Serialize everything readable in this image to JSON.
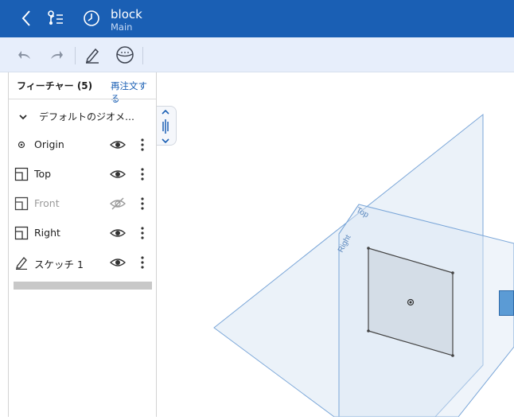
{
  "header": {
    "title": "block",
    "subtitle": "Main"
  },
  "panel": {
    "title": "フィーチャー (5)",
    "action": "再注文する",
    "group": {
      "label": "デフォルトのジオメ…"
    },
    "features": [
      {
        "label": "Origin",
        "icon": "origin-icon",
        "visible": true
      },
      {
        "label": "Top",
        "icon": "plane-icon",
        "visible": true
      },
      {
        "label": "Front",
        "icon": "plane-icon",
        "visible": false
      },
      {
        "label": "Right",
        "icon": "plane-icon",
        "visible": true
      },
      {
        "label": "スケッチ 1",
        "icon": "sketch-icon",
        "visible": true
      }
    ]
  },
  "viewport": {
    "plane_labels": {
      "top": "Top",
      "right": "Right"
    }
  },
  "colors": {
    "header_bg": "#1a5fb4",
    "toolbar_bg": "#e7eefb",
    "accent": "#1a5fb4",
    "plane_fill": "#dbe7f4",
    "plane_stroke": "#6c9bd1"
  }
}
